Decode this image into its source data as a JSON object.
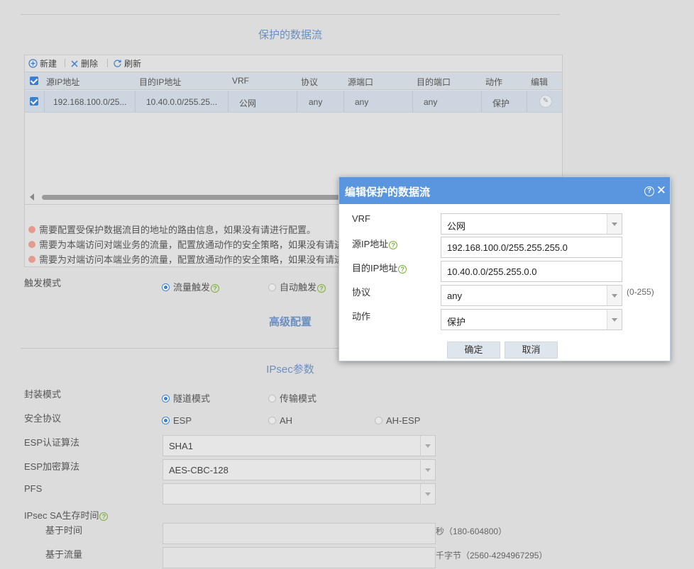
{
  "protected_flow": {
    "section_title": "保护的数据流",
    "toolbar": {
      "new_label": "新建",
      "delete_label": "删除",
      "refresh_label": "刷新"
    },
    "columns": [
      "源IP地址",
      "目的IP地址",
      "VRF",
      "协议",
      "源端口",
      "目的端口",
      "动作",
      "编辑"
    ],
    "rows": [
      {
        "src_ip": "192.168.100.0/25...",
        "dst_ip": "10.40.0.0/255.25...",
        "vrf": "公网",
        "protocol": "any",
        "src_port": "any",
        "dst_port": "any",
        "action": "保护"
      }
    ],
    "notes": [
      "需要配置受保护数据流目的地址的路由信息，如果没有请进行配置。",
      "需要为本端访问对端业务的流量，配置放通动作的安全策略，如果没有请进行配置。",
      "需要为对端访问本端业务的流量，配置放通动作的安全策略，如果没有请进行配置。"
    ]
  },
  "trigger": {
    "label": "触发模式",
    "option_flow": "流量触发",
    "option_auto": "自动触发"
  },
  "advanced": {
    "title": "高级配置"
  },
  "ipsec": {
    "title": "IPsec参数",
    "encap_label": "封装模式",
    "encap_tunnel": "隧道模式",
    "encap_transport": "传输模式",
    "protocol_label": "安全协议",
    "protocol_esp": "ESP",
    "protocol_ah": "AH",
    "protocol_ahesp": "AH-ESP",
    "esp_auth_label": "ESP认证算法",
    "esp_auth_value": "SHA1",
    "esp_enc_label": "ESP加密算法",
    "esp_enc_value": "AES-CBC-128",
    "pfs_label": "PFS",
    "pfs_value": "",
    "lifetime_label": "IPsec SA生存时间",
    "time_label": "基于时间",
    "time_hint": "秒（180-604800）",
    "traffic_label": "基于流量",
    "traffic_hint": "千字节（2560-4294967295）"
  },
  "dialog": {
    "title": "编辑保护的数据流",
    "vrf_label": "VRF",
    "vrf_value": "公网",
    "src_label": "源IP地址",
    "src_value": "192.168.100.0/255.255.255.0",
    "dst_label": "目的IP地址",
    "dst_value": "10.40.0.0/255.255.0.0",
    "protocol_label": "协议",
    "protocol_value": "any",
    "protocol_hint": "(0-255)",
    "action_label": "动作",
    "action_value": "保护",
    "ok_label": "确定",
    "cancel_label": "取消"
  },
  "colors": {
    "accent": "#5a96df",
    "link_title": "#6a8fc0",
    "help_green": "#7fb03a",
    "note_dot": "#e59a90"
  }
}
